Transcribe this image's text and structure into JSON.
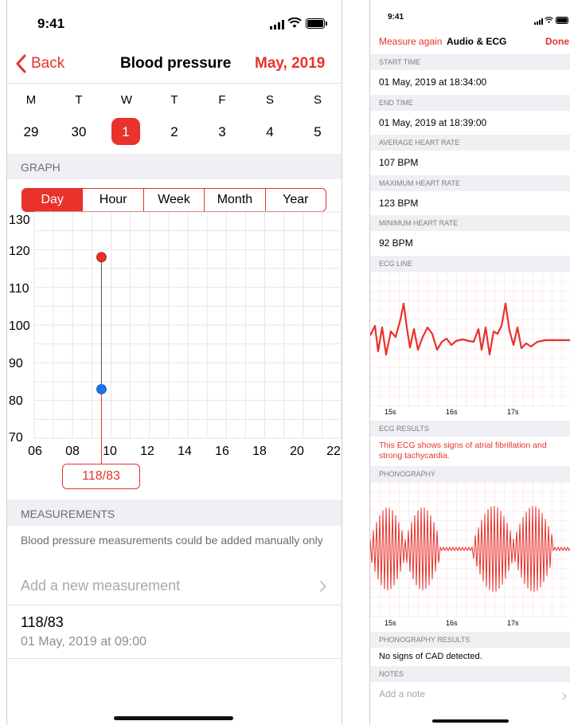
{
  "left": {
    "status_time": "9:41",
    "nav": {
      "back_label": "Back",
      "title": "Blood pressure",
      "month": "May, 2019"
    },
    "week": {
      "weekdays": [
        "M",
        "T",
        "W",
        "T",
        "F",
        "S",
        "S"
      ],
      "days": [
        "29",
        "30",
        "1",
        "2",
        "3",
        "4",
        "5"
      ],
      "selected_index": 2
    },
    "graph_header": "GRAPH",
    "segments": [
      "Day",
      "Hour",
      "Week",
      "Month",
      "Year"
    ],
    "active_segment": "Day",
    "chart_data": {
      "type": "scatter",
      "y_ticks": [
        "130",
        "120",
        "110",
        "100",
        "90",
        "80",
        "70"
      ],
      "x_ticks": [
        "06",
        "08",
        "10",
        "12",
        "14",
        "16",
        "18",
        "20",
        "22"
      ],
      "ylim": [
        70,
        130
      ],
      "xlim": [
        6,
        22
      ],
      "points": [
        {
          "x": 9.5,
          "systolic": 118,
          "diastolic": 83
        }
      ],
      "colors": {
        "systolic": "#e8322b",
        "diastolic": "#1a73e8",
        "grid": "#e6e6e6"
      },
      "grid": true,
      "callout": "118/83"
    },
    "measurements_header": "MEASUREMENTS",
    "measurements_note": "Blood pressure measurements could be added manually only",
    "add_measurement": "Add a new measurement",
    "entry": {
      "value": "118/83",
      "date": "01 May, 2019 at 09:00"
    }
  },
  "right": {
    "status_time": "9:41",
    "nav": {
      "measure_again": "Measure again",
      "title": "Audio & ECG",
      "done": "Done"
    },
    "start_time_header": "START TIME",
    "start_time": "01 May, 2019 at 18:34:00",
    "end_time_header": "END TIME",
    "end_time": "01 May, 2019 at 18:39:00",
    "avg_hr_header": "AVERAGE HEART RATE",
    "avg_hr": "107 BPM",
    "max_hr_header": "MAXIMUM HEART RATE",
    "max_hr": "123 BPM",
    "min_hr_header": "MINIMUM HEART RATE",
    "min_hr": "92 BPM",
    "ecg_header": "ECG LINE",
    "ecg_time_labels": [
      "15s",
      "16s",
      "17s"
    ],
    "ecg_results_header": "ECG RESULTS",
    "ecg_results": "This ECG shows signs of atrial fibrillation and strong tachycardia.",
    "phono_header": "PHONOGRAPHY",
    "phono_time_labels": [
      "15s",
      "16s",
      "17s"
    ],
    "phono_results_header": "PHONOGRAPHY RESULTS",
    "phono_results": "No signs of CAD detected.",
    "notes_header": "NOTES",
    "notes_placeholder": "Add a note",
    "accent": "#e8322b"
  }
}
